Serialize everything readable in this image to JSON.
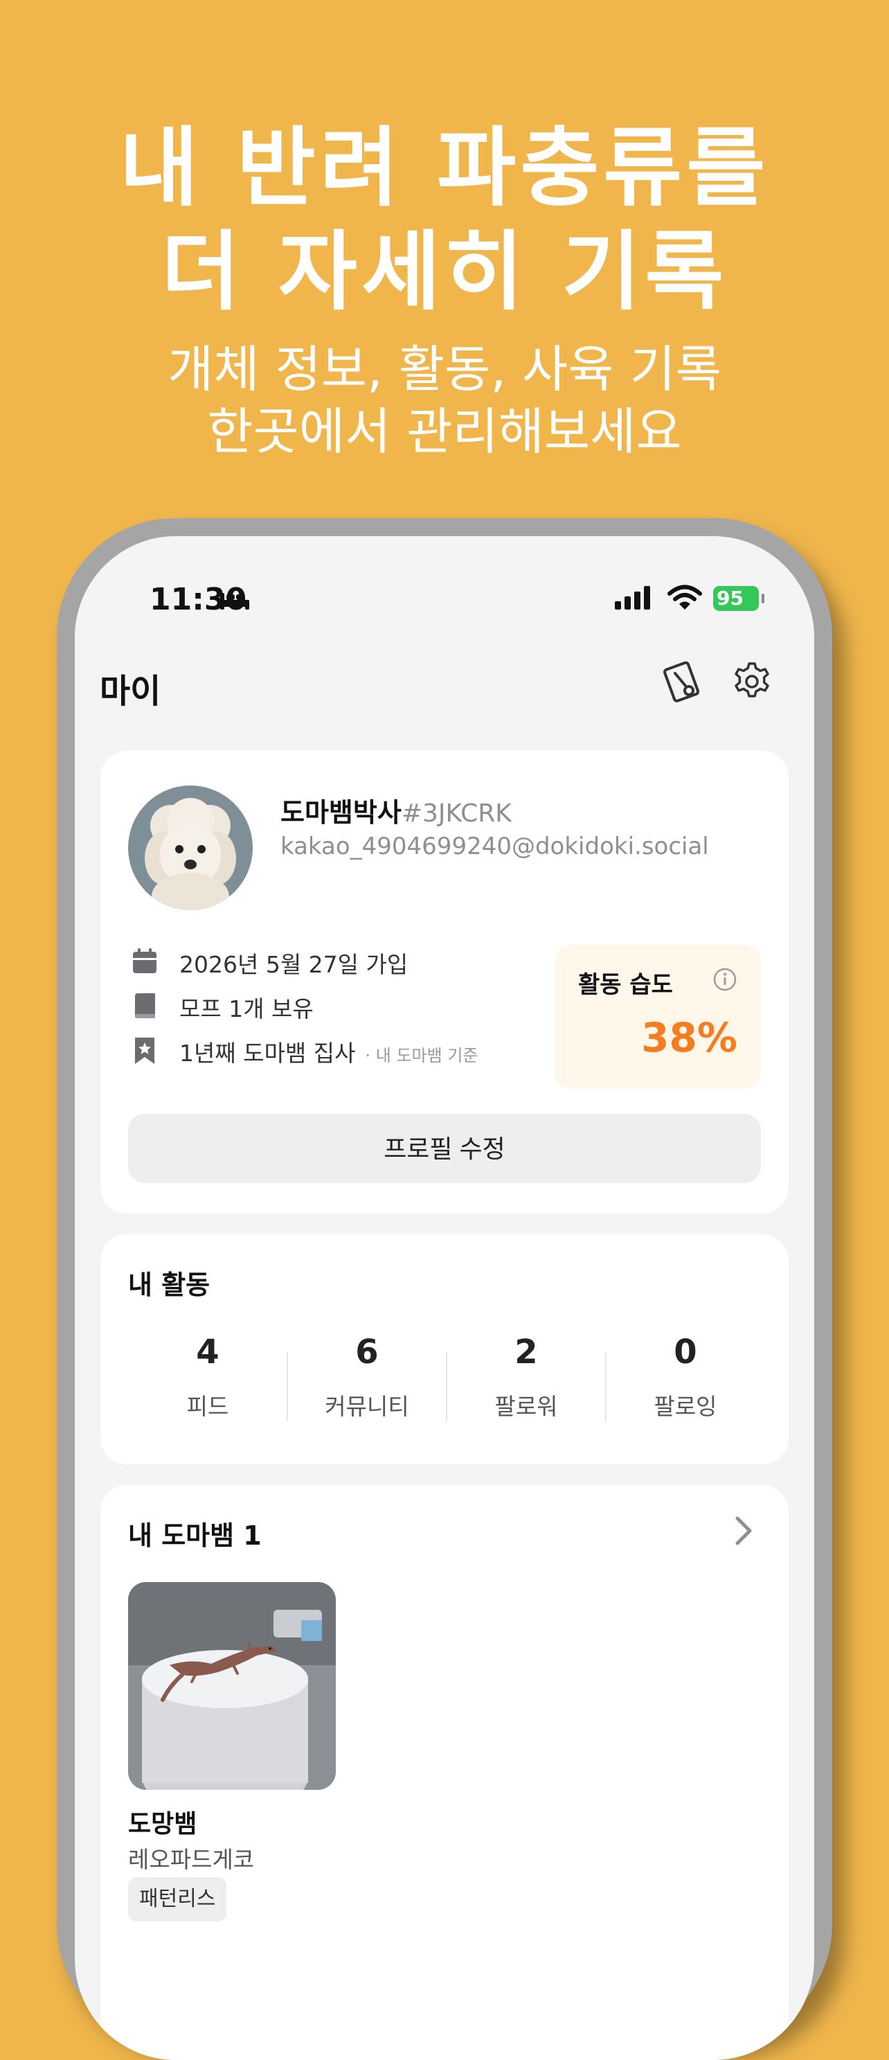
{
  "promo": {
    "headline_line1": "내 반려 파충류를",
    "headline_line2": "더 자세히 기록",
    "subtitle_line1": "개체 정보, 활동, 사육 기록",
    "subtitle_line2": "한곳에서 관리해보세요"
  },
  "status_bar": {
    "time": "11:30",
    "battery": "95"
  },
  "header": {
    "title": "마이"
  },
  "profile": {
    "nickname": "도마뱀박사",
    "tag": "#3JKCRK",
    "email": "kakao_4904699240@dokidoki.social",
    "joined": "2026년 5월 27일 가입",
    "owned": "모프 1개 보유",
    "keeper": "1년째 도마뱀 집사",
    "keeper_note": "· 내 도마뱀 기준",
    "humidity_label": "활동 습도",
    "humidity_value": "38%",
    "edit_label": "프로필 수정"
  },
  "activity": {
    "title": "내 활동",
    "stats": [
      {
        "value": "4",
        "label": "피드"
      },
      {
        "value": "6",
        "label": "커뮤니티"
      },
      {
        "value": "2",
        "label": "팔로워"
      },
      {
        "value": "0",
        "label": "팔로잉"
      }
    ]
  },
  "pets": {
    "title": "내 도마뱀 1",
    "items": [
      {
        "name": "도망뱀",
        "species": "레오파드게코",
        "morph": "패턴리스"
      }
    ]
  },
  "icons": [
    "bed-icon",
    "signal-icon",
    "wifi-icon",
    "battery-icon",
    "pass-icon",
    "gear-icon",
    "calendar-icon",
    "book-icon",
    "bookmark-star-icon",
    "info-icon",
    "chevron-right-icon"
  ],
  "colors": {
    "background": "#F0B64C",
    "accent": "#F57C1F",
    "battery": "#34C759"
  }
}
